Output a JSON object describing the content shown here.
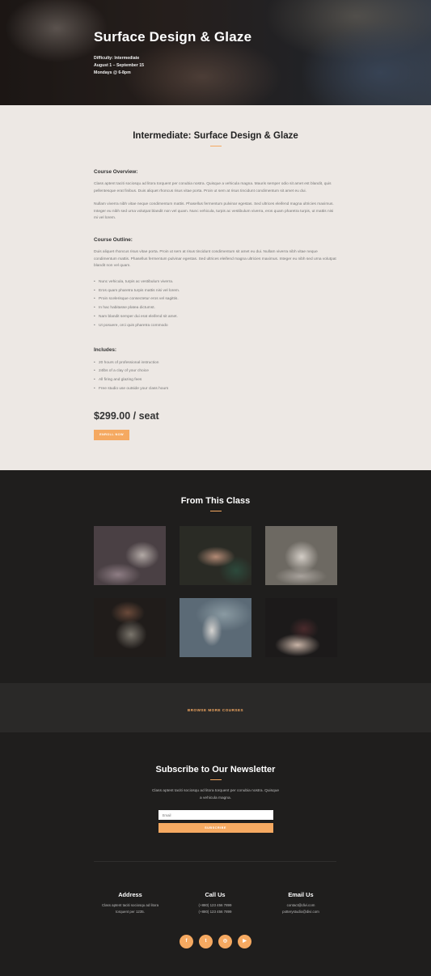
{
  "hero": {
    "title": "Surface Design & Glaze",
    "difficulty": "Difficulty: Intermediate",
    "dates": "August 1 – September 15",
    "schedule": "Mondays @ 6-8pm"
  },
  "main": {
    "title": "Intermediate: Surface Design & Glaze",
    "overview_heading": "Course Overview:",
    "overview_p1": "Class aptent taciti sociosqu ad litora torquent per conubia nostra. Quisque a vehicula magna. Mauris semper odio sit amet est blandit, quis pellentesque erat finibus. Duis aliquet rhoncus risus vitae porta. Proin ut sem at risus tincidunt condimentum sit amet eu dui.",
    "overview_p2": "Nullam viverra nibh vitae neque condimentum mattis. Phasellus fermentum pulvinar egestas. Sed ultrices eleifend magna ultricies maximus. Integer eu nibh sed urna volutpat blandit non vel quam. Nunc vehicula, turpis ac vestibulum viverra, eros quam pharetra turpis, ut mattis nisi mi vel lorem.",
    "outline_heading": "Course Outline:",
    "outline_p": "Duis aliquet rhoncus risus vitae porta. Proin ut sem at risus tincidunt condimentum sit amet eu dui. Nullam viverra nibh vitae neque condimentum mattis. Phasellus fermentum pulvinar egestas. Sed ultrices eleifend magna ultricies maximus. Integer eu nibh sed urna volutpat blandit non vel quam.",
    "outline_items": [
      "Nunc vehicula, turpis ac vestibulum viverra.",
      "Eros quam pharetra turpis mattis nisi vel lorem.",
      "Proin scelerisque consectetur eros vel sagittis.",
      "In hac habitasse platea dictumst.",
      "Nam blandit semper dui erat eleifend sit amet.",
      "Ut posuere, orci quis pharetra commodo"
    ],
    "includes_heading": "Includes:",
    "includes_items": [
      "20 hours of professional instruction",
      "24lbs of a clay of your choice",
      "All firing and glazing fees",
      "Free studio use outside your class hours"
    ],
    "price": "$299.00 / seat",
    "enroll_label": "ENROLL NOW"
  },
  "gallery": {
    "title": "From This Class"
  },
  "browse": {
    "label": "BROWSE MORE COURSES"
  },
  "newsletter": {
    "title": "Subscribe to Our Newsletter",
    "text": "Class aptent taciti sociosqu ad litora torquent per conubia nostra. Quisque a vehicula magna.",
    "email_placeholder": "Email",
    "subscribe_label": "SUBSCRIBE"
  },
  "contact": {
    "address_heading": "Address",
    "address_text": "Class aptent taciti sociosqu ad litora torquent per 1235.",
    "call_heading": "Call Us",
    "phone1": "(+880) 123 456 7899",
    "phone2": "(+880) 123 456 7899",
    "email_heading": "Email Us",
    "email1": "contact@divi.com",
    "email2": "potterystudio@divi.com"
  },
  "socials": [
    {
      "icon": "facebook-icon",
      "glyph": "f"
    },
    {
      "icon": "twitter-icon",
      "glyph": "t"
    },
    {
      "icon": "instagram-icon",
      "glyph": "◎"
    },
    {
      "icon": "youtube-icon",
      "glyph": "▶"
    }
  ],
  "colors": {
    "accent": "#f5a961",
    "dark_bg": "#1f1e1d",
    "light_bg": "#ede8e4"
  }
}
